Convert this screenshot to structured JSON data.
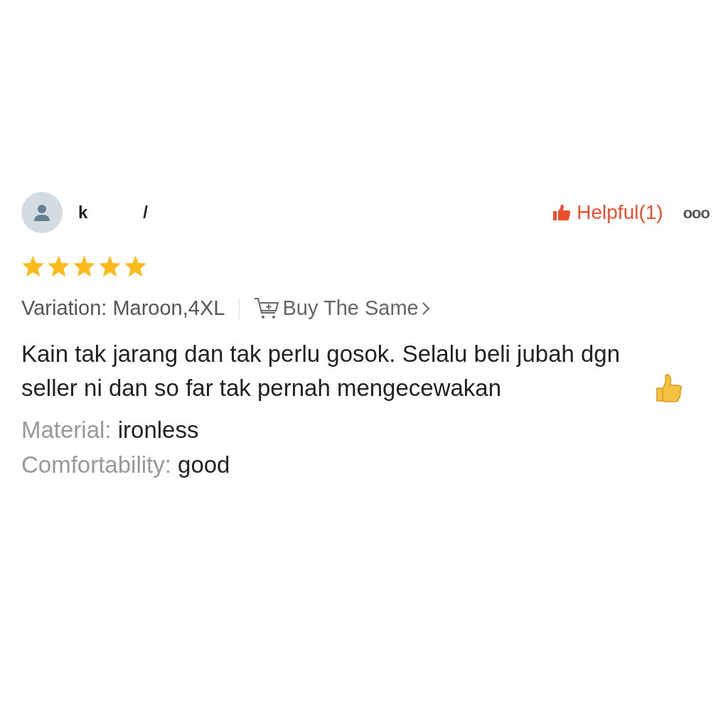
{
  "review": {
    "username_parts": [
      "k",
      "/"
    ],
    "helpful": {
      "label": "Helpful(1)",
      "selected": true
    },
    "more": "ooo",
    "stars": 5,
    "variation": "Variation: Maroon,4XL",
    "buy_same": "Buy The Same",
    "text": "Kain tak jarang dan tak perlu gosok. Selalu beli jubah dgn seller ni dan so far tak pernah mengecewakan",
    "attributes": [
      {
        "label": "Material:",
        "value": "ironless"
      },
      {
        "label": "Comfortability:",
        "value": "good"
      }
    ]
  }
}
